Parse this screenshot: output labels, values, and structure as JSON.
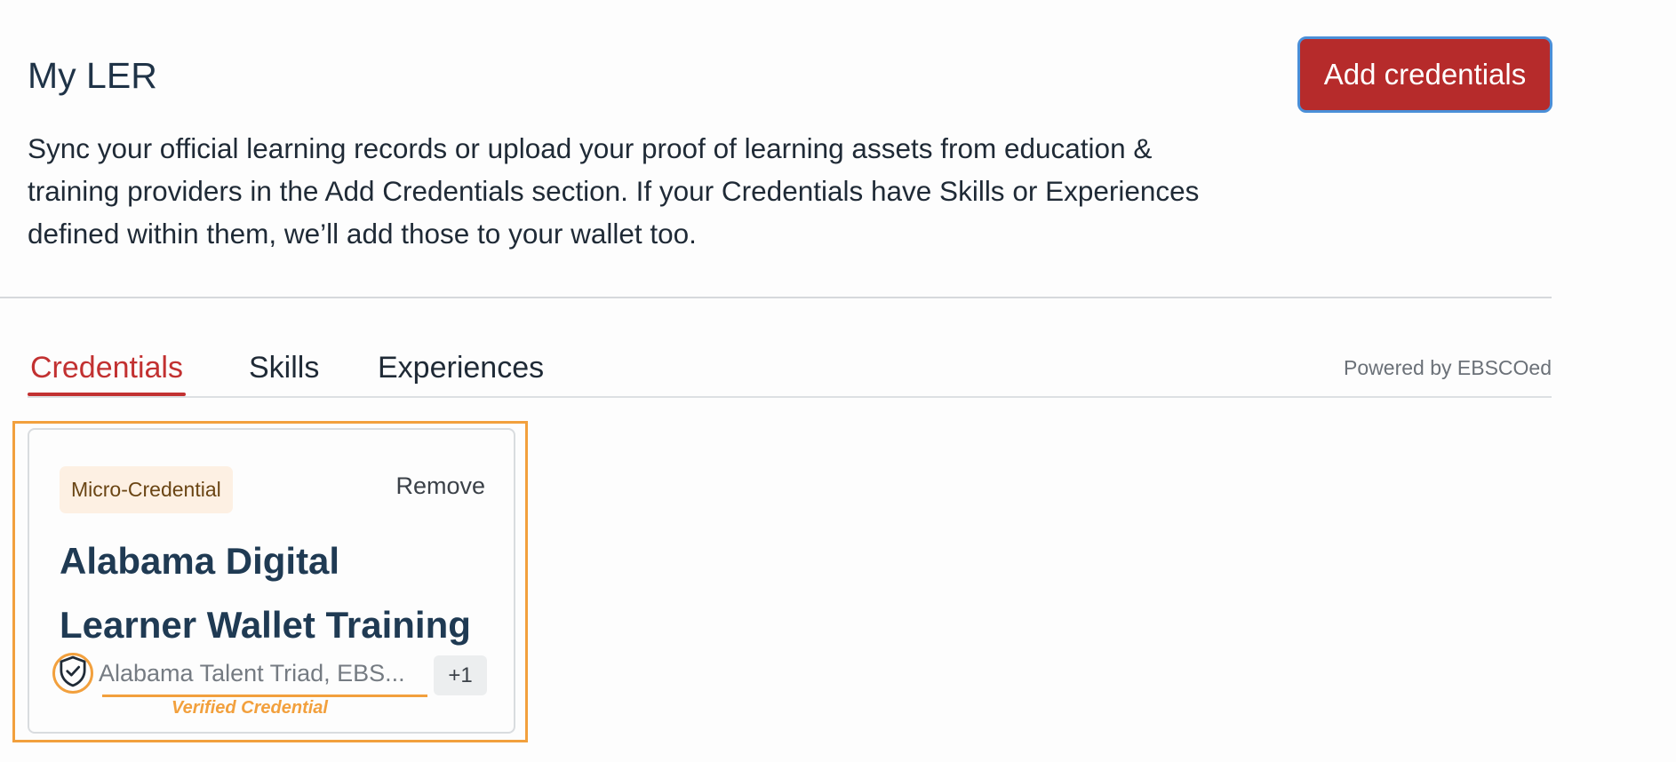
{
  "header": {
    "title": "My LER",
    "add_button_label": "Add credentials",
    "description": "Sync your official learning records or upload your proof of learning assets from education & training providers in the Add Credentials section. If your Credentials have Skills or Experiences defined within them, we’ll add those to your wallet too."
  },
  "tabs": [
    {
      "label": "Credentials",
      "active": true
    },
    {
      "label": "Skills",
      "active": false
    },
    {
      "label": "Experiences",
      "active": false
    }
  ],
  "powered_by": "Powered by EBSCOed",
  "card": {
    "type_badge": "Micro-Credential",
    "remove_label": "Remove",
    "title": "Alabama Digital Learner Wallet Training",
    "issuer": "Alabama Talent Triad, EBS...",
    "more_count": "+1",
    "icon": "shield-check-icon"
  },
  "annotation": {
    "label": "Verified Credential",
    "color": "#f2a03d"
  },
  "colors": {
    "accent": "#b62b2b",
    "active_tab": "#c23131",
    "focus_ring": "#4a8fd8"
  }
}
